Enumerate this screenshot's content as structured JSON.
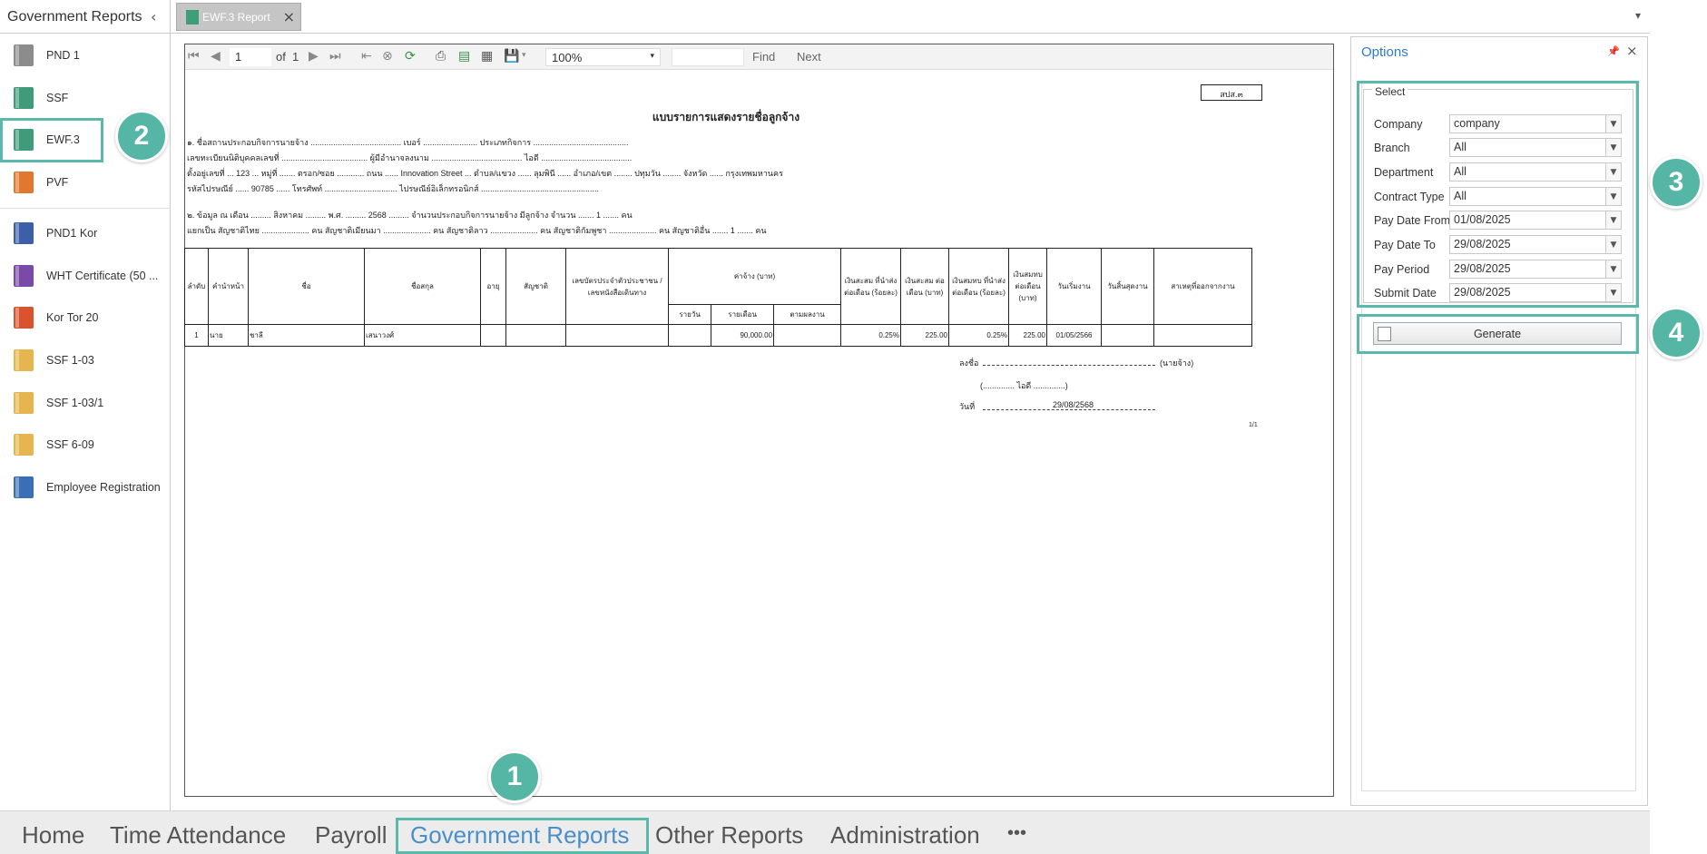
{
  "sidebar": {
    "title": "Government Reports",
    "items": [
      {
        "label": "PND 1",
        "color": "#8c8c8c"
      },
      {
        "label": "SSF",
        "color": "#3f9b7a"
      },
      {
        "label": "EWF.3",
        "color": "#3f9b7a"
      },
      {
        "label": "PVF",
        "color": "#e0782f"
      },
      {
        "label": "PND1 Kor",
        "color": "#3b5fa8"
      },
      {
        "label": "WHT Certificate (50 ...",
        "color": "#7a4aa8"
      },
      {
        "label": "Kor Tor 20",
        "color": "#d9532e"
      },
      {
        "label": "SSF 1-03",
        "color": "#e6b54f"
      },
      {
        "label": "SSF 1-03/1",
        "color": "#e6b54f"
      },
      {
        "label": "SSF 6-09",
        "color": "#e6b54f"
      },
      {
        "label": "Employee Registration",
        "color": "#3b6fb5"
      }
    ]
  },
  "document_tab": {
    "label": "EWF.3 Report"
  },
  "report_toolbar": {
    "page": "1",
    "of_label": "of",
    "total_pages": "1",
    "zoom": "100%",
    "find": "Find",
    "next": "Next"
  },
  "report": {
    "form_code": "สปส.๓",
    "title": "แบบรายการแสดงรายชื่อลูกจ้าง",
    "line1": "๑. ชื่อสถานประกอบกิจการนายจ้าง ........................................ เบอร์ ........................ ประเภทกิจการ ..........................................",
    "line2": "เลขทะเบียนนิติบุคคลเลขที่ ...................................... ผู้มีอำนาจลงนาม ........................................ ไอดี ........................................",
    "line3": "ตั้งอยู่เลขที่ ... 123 ... หมู่ที่ ....... ตรอก/ซอย ............ ถนน ...... Innovation Street ... ตำบล/แขวง ...... ลุมพินี ...... อำเภอ/เขต ........ ปทุมวัน ........ จังหวัด ...... กรุงเทพมหานคร",
    "line4": "รหัสไปรษณีย์ ...... 90785 ...... โทรศัพท์ ................................ ไปรษณีย์อิเล็กทรอนิกส์ ....................................................",
    "line5": "๒. ข้อมูล ณ เดือน ......... สิงหาคม ......... พ.ศ. ......... 2568 ......... จำนวนประกอบกิจการนายจ้าง มีลูกจ้าง จำนวน ....... 1 ....... คน",
    "line6": "แยกเป็น สัญชาติไทย ..................... คน สัญชาติเมียนมา ..................... คน สัญชาติลาว ..................... คน สัญชาติกัมพูชา ..................... คน สัญชาติอื่น ....... 1 ....... คน",
    "headers": [
      "ลำดับ",
      "คำนำหน้า",
      "ชื่อ",
      "ชื่อสกุล",
      "อายุ",
      "สัญชาติ",
      "เลขบัตรประจำตัวประชาชน / เลขหนังสือเดินทาง",
      "ค่าจ้าง (บาท)",
      "เงินสะสม ที่นำส่งต่อเดือน (ร้อยละ)",
      "เงินสะสม ต่อเดือน (บาท)",
      "เงินสมทบ ที่นำส่งต่อเดือน (ร้อยละ)",
      "เงินสมทบ ต่อเดือน (บาท)",
      "วันเริ่มงาน",
      "วันสิ้นสุดงาน",
      "สาเหตุที่ออกจากงาน"
    ],
    "wage_subheaders": [
      "รายวัน",
      "รายเดือน",
      "ตามผลงาน"
    ],
    "row": [
      "1",
      "นาย",
      "ชาลี",
      "เสนาวงศ์",
      "",
      "",
      "",
      "",
      "90,000.00",
      "",
      "0.25%",
      "225.00",
      "0.25%",
      "225.00",
      "01/05/2566",
      "",
      ""
    ],
    "sign_label": "ลงชื่อ",
    "sign_role": "(นายจ้าง)",
    "sign_name": "(.............. ไอดี ..............)",
    "date_label": "วันที่",
    "date_value": "29/08/2568",
    "page_label": "1/1"
  },
  "options": {
    "title": "Options",
    "group_label": "Select",
    "fields": [
      {
        "label": "Company",
        "value": "company"
      },
      {
        "label": "Branch",
        "value": "All"
      },
      {
        "label": "Department",
        "value": "All"
      },
      {
        "label": "Contract Type",
        "value": "All"
      },
      {
        "label": "Pay Date From",
        "value": "01/08/2025"
      },
      {
        "label": "Pay Date To",
        "value": "29/08/2025"
      },
      {
        "label": "Pay Period",
        "value": "29/08/2025"
      },
      {
        "label": "Submit Date",
        "value": "29/08/2025"
      }
    ],
    "generate_label": "Generate"
  },
  "bottom_nav": {
    "items": [
      "Home",
      "Time Attendance",
      "Payroll",
      "Government Reports",
      "Other Reports",
      "Administration"
    ],
    "more": "•••"
  },
  "callouts": [
    "1",
    "2",
    "3",
    "4"
  ],
  "colors": {
    "accent": "#56b6a6",
    "title_blue": "#2b7bd1"
  }
}
